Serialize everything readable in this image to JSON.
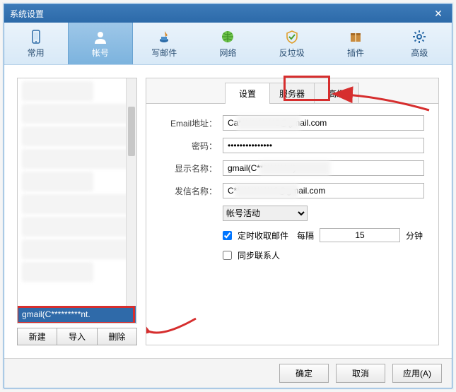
{
  "window": {
    "title": "系统设置"
  },
  "toolbar": [
    {
      "label": "常用",
      "icon": "smartphone-icon"
    },
    {
      "label": "帐号",
      "icon": "user-icon",
      "selected": true
    },
    {
      "label": "写邮件",
      "icon": "inkwell-icon"
    },
    {
      "label": "网络",
      "icon": "globe-icon"
    },
    {
      "label": "反垃圾",
      "icon": "shield-icon"
    },
    {
      "label": "插件",
      "icon": "package-icon"
    },
    {
      "label": "高级",
      "icon": "gear-icon"
    }
  ],
  "left": {
    "selected_label": "gmail(C*********nt.",
    "buttons": {
      "new": "新建",
      "import": "导入",
      "delete": "删除"
    }
  },
  "tabs": {
    "settings": "设置",
    "server": "服务器",
    "advanced": "高级"
  },
  "form": {
    "email_label": "Email地址：",
    "email_value": "Ca***********6@gmail.com",
    "password_label": "密码：",
    "password_value": "***************",
    "display_label": "显示名称：",
    "display_value": "gmail(C***********)",
    "sender_label": "发信名称：",
    "sender_value": "C************6@gmail.com",
    "activity_label": "帐号活动",
    "fetch_label": "定时收取邮件",
    "interval_prefix": "每隔",
    "interval_value": "15",
    "interval_suffix": "分钟",
    "sync_label": "同步联系人"
  },
  "footer": {
    "ok": "确定",
    "cancel": "取消",
    "apply": "应用(A)"
  }
}
